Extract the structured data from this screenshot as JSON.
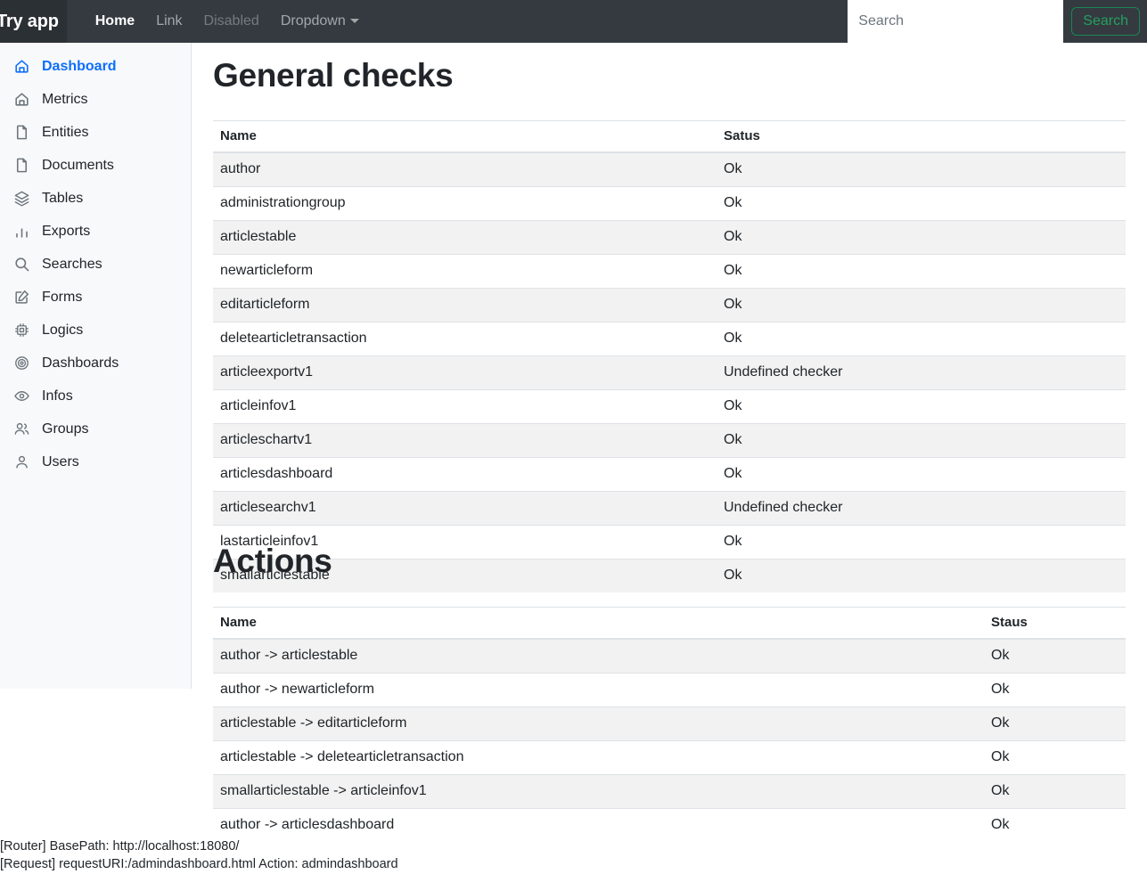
{
  "navbar": {
    "brand": "Try app",
    "links": [
      {
        "label": "Home",
        "state": "active"
      },
      {
        "label": "Link",
        "state": "normal"
      },
      {
        "label": "Disabled",
        "state": "disabled"
      },
      {
        "label": "Dropdown",
        "state": "dropdown"
      }
    ],
    "search": {
      "placeholder": "Search",
      "value": "",
      "button_label": "Search",
      "button_color": "#198754"
    }
  },
  "sidebar": {
    "active_color": "#0d6efd",
    "background": "#f8f9fa",
    "items": [
      {
        "label": "Dashboard",
        "icon": "home-icon",
        "active": true
      },
      {
        "label": "Metrics",
        "icon": "home-icon",
        "active": false
      },
      {
        "label": "Entities",
        "icon": "file-icon",
        "active": false
      },
      {
        "label": "Documents",
        "icon": "file-icon",
        "active": false
      },
      {
        "label": "Tables",
        "icon": "layers-icon",
        "active": false
      },
      {
        "label": "Exports",
        "icon": "bar-chart-icon",
        "active": false
      },
      {
        "label": "Searches",
        "icon": "search-icon",
        "active": false
      },
      {
        "label": "Forms",
        "icon": "edit-square-icon",
        "active": false
      },
      {
        "label": "Logics",
        "icon": "cpu-chip-icon",
        "active": false
      },
      {
        "label": "Dashboards",
        "icon": "target-icon",
        "active": false
      },
      {
        "label": "Infos",
        "icon": "eye-icon",
        "active": false
      },
      {
        "label": "Groups",
        "icon": "users-icon",
        "active": false
      },
      {
        "label": "Users",
        "icon": "user-icon",
        "active": false
      }
    ]
  },
  "main": {
    "general_checks": {
      "title": "General checks",
      "columns": [
        "Name",
        "Satus"
      ],
      "rows": [
        {
          "name": "author",
          "status": "Ok"
        },
        {
          "name": "administrationgroup",
          "status": "Ok"
        },
        {
          "name": "articlestable",
          "status": "Ok"
        },
        {
          "name": "newarticleform",
          "status": "Ok"
        },
        {
          "name": "editarticleform",
          "status": "Ok"
        },
        {
          "name": "deletearticletransaction",
          "status": "Ok"
        },
        {
          "name": "articleexportv1",
          "status": "Undefined checker"
        },
        {
          "name": "articleinfov1",
          "status": "Ok"
        },
        {
          "name": "articleschartv1",
          "status": "Ok"
        },
        {
          "name": "articlesdashboard",
          "status": "Ok"
        },
        {
          "name": "articlesearchv1",
          "status": "Undefined checker"
        },
        {
          "name": "lastarticleinfov1",
          "status": "Ok"
        },
        {
          "name": "smallarticlestable",
          "status": "Ok"
        }
      ]
    },
    "actions": {
      "title": "Actions",
      "columns": [
        "Name",
        "Staus"
      ],
      "rows": [
        {
          "name": "author -> articlestable",
          "status": "Ok"
        },
        {
          "name": "author -> newarticleform",
          "status": "Ok"
        },
        {
          "name": "articlestable -> editarticleform",
          "status": "Ok"
        },
        {
          "name": "articlestable -> deletearticletransaction",
          "status": "Ok"
        },
        {
          "name": "smallarticlestable -> articleinfov1",
          "status": "Ok"
        },
        {
          "name": "author -> articlesdashboard",
          "status": "Ok"
        }
      ]
    }
  },
  "footer_debug": {
    "line1": "[Router] BasePath: http://localhost:18080/",
    "line2": "[Request] requestURI:/admindashboard.html Action: admindashboard"
  }
}
